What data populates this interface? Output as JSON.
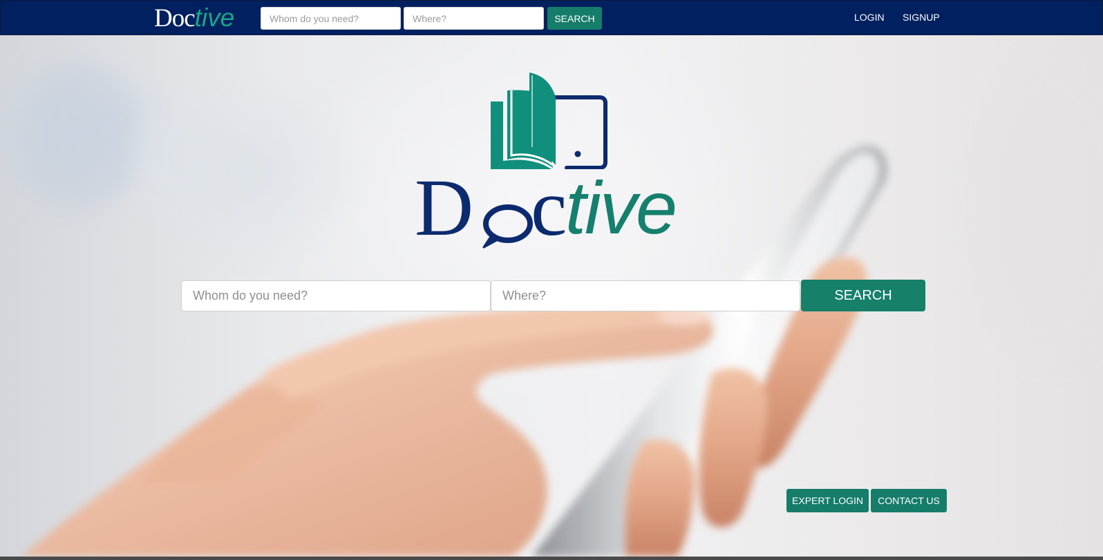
{
  "navbar": {
    "logo_prefix": "Doc",
    "logo_suffix": "tive",
    "who_placeholder": "Whom do you need?",
    "where_placeholder": "Where?",
    "search_label": "SEARCH",
    "login_label": "LOGIN",
    "signup_label": "SIGNUP"
  },
  "hero": {
    "logo_d": "D",
    "logo_c": "c",
    "logo_suffix": "tive",
    "who_placeholder": "Whom do you need?",
    "where_placeholder": "Where?",
    "search_label": "SEARCH"
  },
  "footer": {
    "expert_login_label": "EXPERT LOGIN",
    "contact_us_label": "CONTACT US"
  },
  "colors": {
    "navbar_bg": "#002060",
    "accent_green": "#157d6a",
    "logo_blue": "#0c2a6e",
    "logo_teal": "#0f8f7c"
  }
}
